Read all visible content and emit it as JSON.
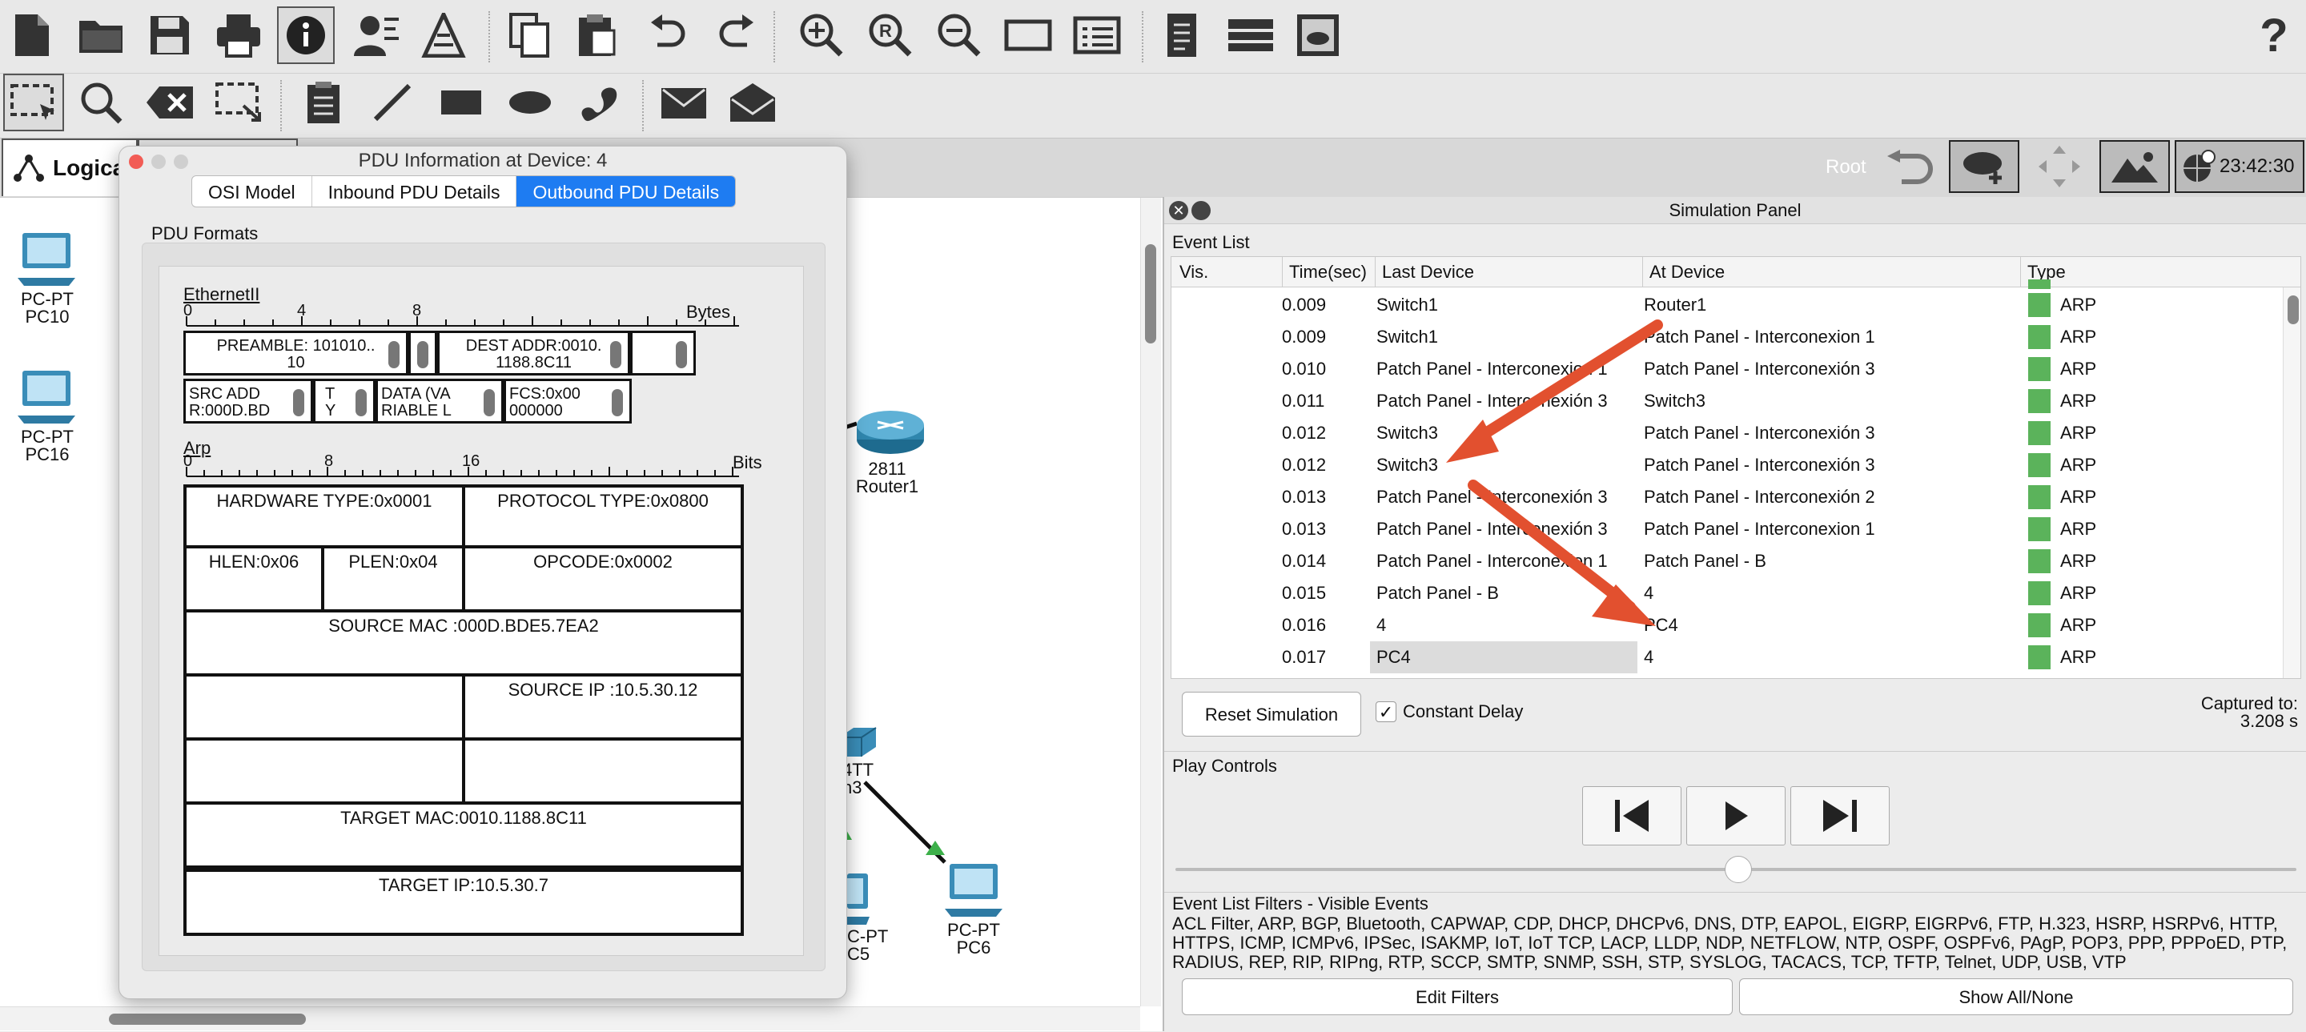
{
  "toolbar1": {
    "icons": [
      "new-file-icon",
      "open-folder-icon",
      "save-icon",
      "print-icon",
      "info-icon",
      "activity-wizard-icon",
      "custom-device-icon",
      "copy-icon",
      "paste-icon",
      "undo-icon",
      "redo-icon",
      "zoom-in-icon",
      "zoom-reset-icon",
      "zoom-out-icon",
      "drawing-palette-icon",
      "custom-device-dialog-icon",
      "notes-icon",
      "server-icon",
      "screenshot-icon",
      "help-icon"
    ],
    "help_label": "?"
  },
  "toolbar2": {
    "icons": [
      "select-icon",
      "inspect-icon",
      "delete-icon",
      "resize-icon",
      "note-icon",
      "line-icon",
      "rectangle-icon",
      "ellipse-icon",
      "freeform-icon",
      "add-simple-pdu-icon",
      "add-complex-pdu-icon"
    ]
  },
  "tabs": {
    "logical": "Logica"
  },
  "topbar": {
    "root_label": "Root",
    "clock": "23:42:30"
  },
  "devices": {
    "pc10": {
      "type": "PC-PT",
      "name": "PC10"
    },
    "pc16": {
      "type": "PC-PT",
      "name": "PC16"
    },
    "router1": {
      "model": "2811",
      "name": "Router1"
    },
    "switch3": {
      "model": "4TT",
      "name": "h3"
    },
    "pc5": {
      "type": "C-PT",
      "name": "C5"
    },
    "pc6": {
      "type": "PC-PT",
      "name": "PC6"
    }
  },
  "pdu_window": {
    "title": "PDU Information at Device: 4",
    "tabs": [
      "OSI Model",
      "Inbound PDU Details",
      "Outbound PDU Details"
    ],
    "active_tab": 2,
    "section_label": "PDU Formats",
    "ethernet": {
      "title": "EthernetII",
      "ruler_labels": [
        "0",
        "4",
        "8"
      ],
      "unit": "Bytes",
      "preamble": "PREAMBLE: 101010..\n10",
      "dest_addr": "DEST ADDR:0010.\n1188.8C11",
      "src_addr": "SRC ADD\nR:000D.BD",
      "type": "T\nY",
      "data": "DATA (VA\nRIABLE L",
      "fcs": "FCS:0x00\n000000"
    },
    "arp": {
      "title": "Arp",
      "ruler_labels": [
        "0",
        "8",
        "16"
      ],
      "unit": "Bits",
      "hardware_type": "HARDWARE TYPE:0x0001",
      "protocol_type": "PROTOCOL TYPE:0x0800",
      "hlen": "HLEN:0x06",
      "plen": "PLEN:0x04",
      "opcode": "OPCODE:0x0002",
      "source_mac": "SOURCE MAC :000D.BDE5.7EA2",
      "source_ip": "SOURCE IP :10.5.30.12",
      "target_mac": "TARGET MAC:0010.1188.8C11",
      "target_ip": "TARGET IP:10.5.30.7"
    }
  },
  "simulation_panel": {
    "title": "Simulation Panel",
    "event_list_label": "Event List",
    "columns": [
      "Vis.",
      "Time(sec)",
      "Last Device",
      "At Device",
      "Type"
    ],
    "events": [
      {
        "time": "0.009",
        "last": "Switch1",
        "at": "Router1",
        "type": "ARP"
      },
      {
        "time": "0.009",
        "last": "Switch1",
        "at": "Patch Panel - Interconexion 1",
        "type": "ARP"
      },
      {
        "time": "0.010",
        "last": "Patch Panel - Interconexion 1",
        "at": "Patch Panel - Interconexión 3",
        "type": "ARP"
      },
      {
        "time": "0.011",
        "last": "Patch Panel - Interconexión 3",
        "at": "Switch3",
        "type": "ARP"
      },
      {
        "time": "0.012",
        "last": "Switch3",
        "at": "Patch Panel - Interconexión 3",
        "type": "ARP"
      },
      {
        "time": "0.012",
        "last": "Switch3",
        "at": "Patch Panel - Interconexión 3",
        "type": "ARP"
      },
      {
        "time": "0.013",
        "last": "Patch Panel - Interconexión 3",
        "at": "Patch Panel - Interconexión 2",
        "type": "ARP"
      },
      {
        "time": "0.013",
        "last": "Patch Panel - Interconexión 3",
        "at": "Patch Panel - Interconexion 1",
        "type": "ARP"
      },
      {
        "time": "0.014",
        "last": "Patch Panel - Interconexion 1",
        "at": "Patch Panel - B",
        "type": "ARP"
      },
      {
        "time": "0.015",
        "last": "Patch Panel - B",
        "at": "4",
        "type": "ARP"
      },
      {
        "time": "0.016",
        "last": "4",
        "at": "PC4",
        "type": "ARP"
      },
      {
        "time": "0.017",
        "last": "PC4",
        "at": "4",
        "type": "ARP"
      }
    ],
    "type_color": "#5bb35b",
    "reset_label": "Reset Simulation",
    "constant_delay_label": "Constant Delay",
    "constant_delay_checked": true,
    "captured_label": "Captured to:",
    "captured_value": "3.208 s",
    "play_controls_label": "Play Controls",
    "filters_label": "Event List Filters - Visible Events",
    "filters_text": "ACL Filter, ARP, BGP, Bluetooth, CAPWAP, CDP, DHCP, DHCPv6, DNS, DTP, EAPOL, EIGRP, EIGRPv6, FTP, H.323, HSRP, HSRPv6, HTTP, HTTPS, ICMP, ICMPv6, IPSec, ISAKMP, IoT, IoT TCP, LACP, LLDP, NDP, NETFLOW, NTP, OSPF, OSPFv6, PAgP, POP3, PPP, PPPoED, PTP, RADIUS, REP, RIP, RIPng, RTP, SCCP, SMTP, SNMP, SSH, STP, SYSLOG, TACACS, TCP, TFTP, Telnet, UDP, USB, VTP",
    "edit_filters_label": "Edit Filters",
    "show_all_label": "Show All/None"
  },
  "colors": {
    "accent": "#1e7cf2",
    "arrow": "#e2502f",
    "event_type": "#5bb35b"
  }
}
